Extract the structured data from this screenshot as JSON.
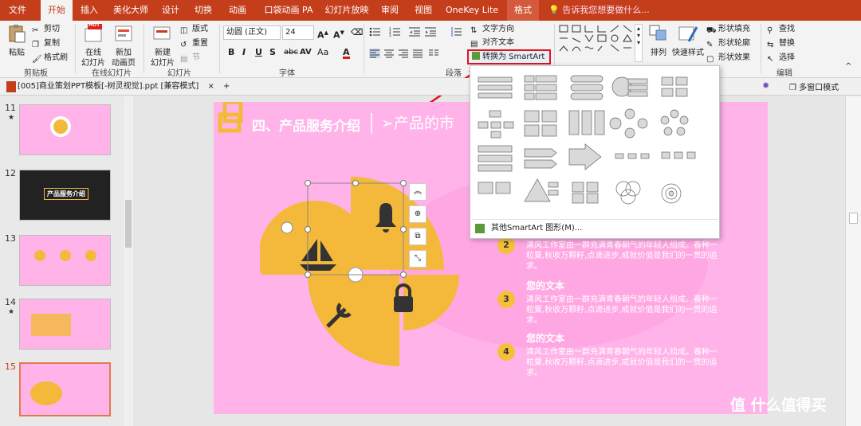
{
  "tabs": [
    "文件",
    "开始",
    "插入",
    "美化大师",
    "设计",
    "切换",
    "动画",
    "口袋动画 PA",
    "幻灯片放映",
    "审阅",
    "视图",
    "OneKey Lite",
    "格式"
  ],
  "active_tab": "开始",
  "tell_me": "告诉我您想要做什么...",
  "ribbon": {
    "clipboard": {
      "paste": "粘贴",
      "cut": "剪切",
      "copy": "复制",
      "format_painter": "格式刷",
      "label": "剪贴板"
    },
    "online": {
      "online_slides": "在线\n幻灯片",
      "new_anim_page": "新加\n动画页",
      "label": "在线幻灯片",
      "hot": "HOT"
    },
    "slides": {
      "new_slide": "新建\n幻灯片",
      "layout": "版式",
      "reset": "重置",
      "section": "节",
      "label": "幻灯片"
    },
    "font": {
      "font_name": "幼圆 (正文)",
      "font_size": "24",
      "label": "字体",
      "bold": "B",
      "italic": "I",
      "underline": "U",
      "shadow": "S",
      "strike": "abc",
      "spacing": "AV",
      "case": "Aa",
      "color": "A"
    },
    "paragraph": {
      "text_direction": "文字方向",
      "align_text": "对齐文本",
      "smartart": "转换为 SmartArt",
      "label": "段落"
    },
    "drawing": {
      "arrange": "排列",
      "quick_style": "快速样式",
      "shape_fill": "形状填充",
      "shape_outline": "形状轮廓",
      "shape_effect": "形状效果"
    },
    "editing": {
      "find": "查找",
      "replace": "替换",
      "select": "选择",
      "label": "编辑"
    }
  },
  "document": {
    "tab_title": "[005]商业策划PPT模板[-树灵视觉].ppt [兼容模式]",
    "multi_window": "多窗口模式"
  },
  "thumbnails": [
    {
      "num": "11",
      "star": "★",
      "title": ""
    },
    {
      "num": "12",
      "star": "",
      "title": "产品服务介绍"
    },
    {
      "num": "13",
      "star": "",
      "title": ""
    },
    {
      "num": "14",
      "star": "★",
      "title": ""
    },
    {
      "num": "15",
      "star": "",
      "title": ""
    }
  ],
  "slide": {
    "title": "四、产品服务介绍",
    "subtitle": "➢产品的市",
    "items": [
      {
        "num": "2",
        "heading": "",
        "text": "清风工作室由一群充满青春朝气的年轻人组成。春种一粒粟,秋收万颗籽,点滴进步,成就价值是我们的一贯的追求。"
      },
      {
        "num": "3",
        "heading": "您的文本",
        "text": "清风工作室由一群充满青春朝气的年轻人组成。春种一粒粟,秋收万颗籽,点滴进步,成就价值是我们的一贯的追求。"
      },
      {
        "num": "4",
        "heading": "您的文本",
        "text": "清风工作室由一群充满青春朝气的年轻人组成。春种一粒粟,秋收万颗籽,点滴进步,成就价值是我们的一贯的追求。"
      }
    ],
    "bg_color": "#ffb3e9",
    "accent": "#f4b93a"
  },
  "smartart_dropdown": {
    "more": "其他SmartArt 图形(M)..."
  },
  "watermark": "值 什么值得买",
  "colors": {
    "ribbon_red": "#c43e1c",
    "highlight": "#e0141a"
  }
}
